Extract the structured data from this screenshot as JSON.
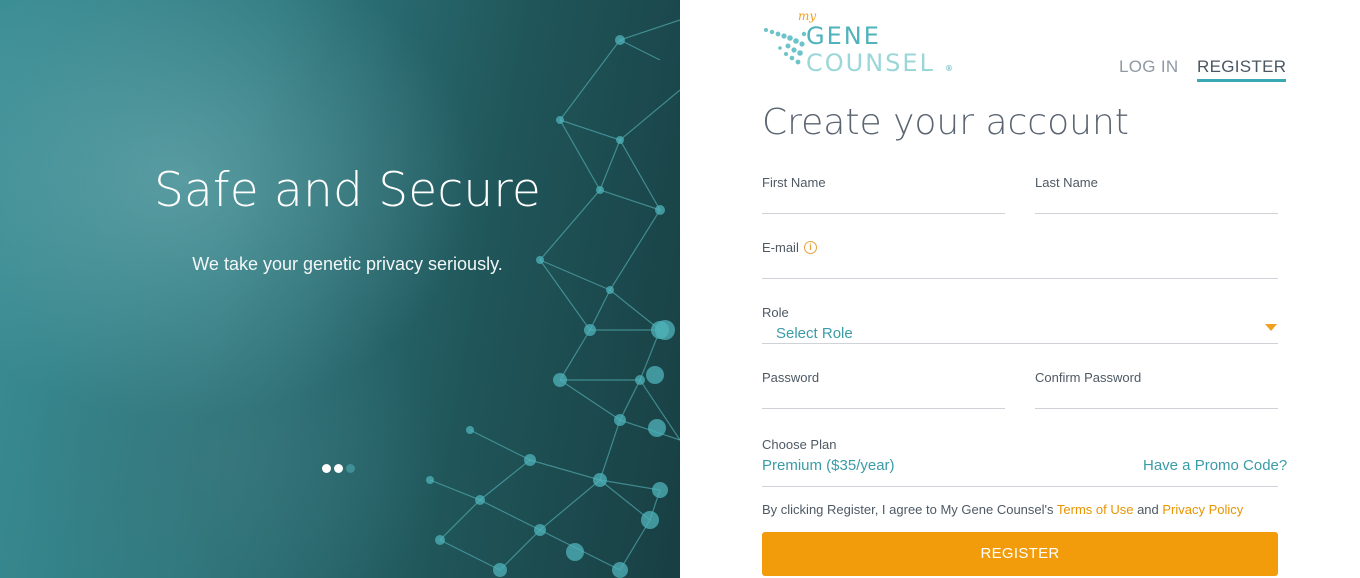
{
  "hero": {
    "title": "Safe and Secure",
    "subtitle": "We take your genetic privacy seriously.",
    "carousel": {
      "count": 3,
      "active": 1
    }
  },
  "brand": {
    "logo_my": "my",
    "logo_gene": "GENE",
    "logo_counsel": "COUNSEL",
    "logo_reg": "®"
  },
  "nav": {
    "login": "LOG IN",
    "register": "REGISTER"
  },
  "form": {
    "title": "Create your account",
    "first_name_label": "First Name",
    "last_name_label": "Last Name",
    "email_label": "E-mail",
    "email_info": "i",
    "role_label": "Role",
    "role_value": "Select Role",
    "password_label": "Password",
    "confirm_password_label": "Confirm Password",
    "plan_label": "Choose Plan",
    "plan_value": "Premium ($35/year)",
    "promo_link": "Have a Promo Code?",
    "terms_prefix": "By clicking Register, I agree to My Gene Counsel's ",
    "terms_link": "Terms of Use",
    "terms_and": " and ",
    "privacy_link": "Privacy Policy",
    "submit": "REGISTER"
  },
  "colors": {
    "accent_teal": "#3aa9b3",
    "accent_orange": "#f29b0b",
    "link_orange": "#e89400"
  }
}
